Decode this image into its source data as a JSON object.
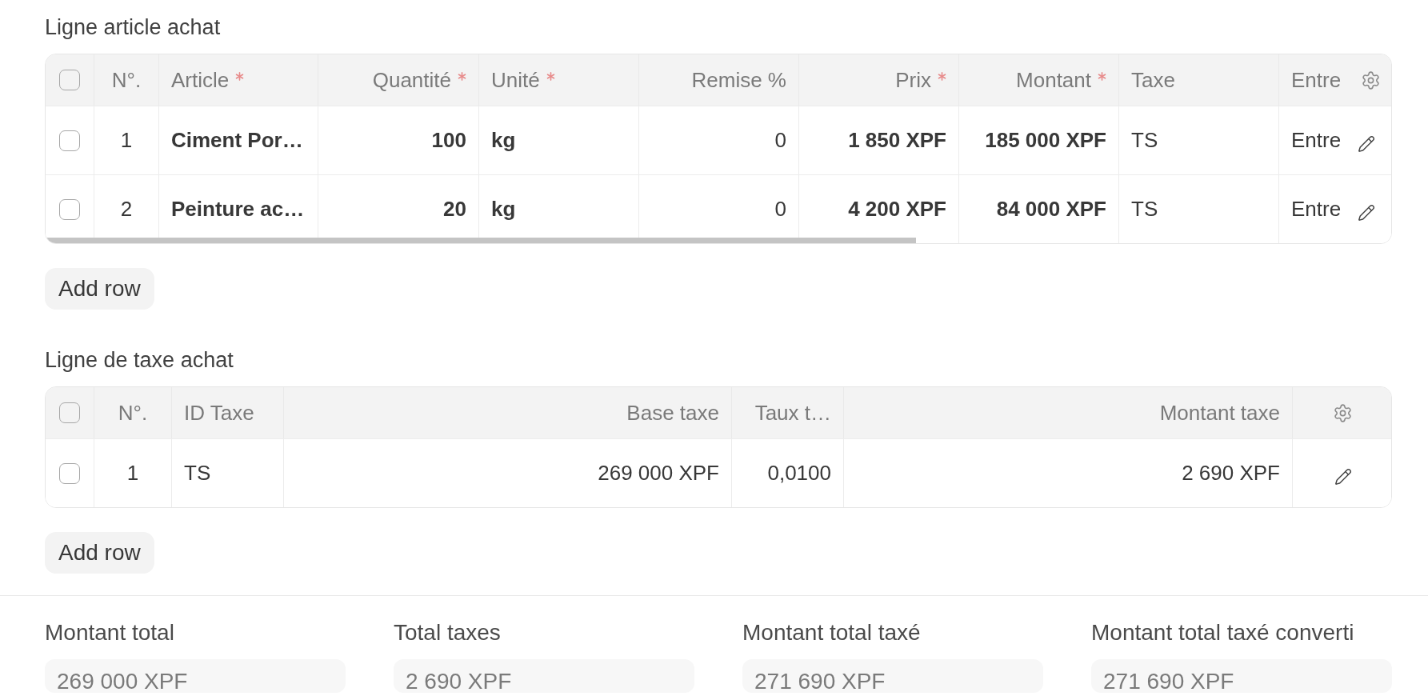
{
  "sections": [
    {
      "title": "Ligne article achat",
      "table": {
        "scrollable": true,
        "all_selected": false,
        "columns": [
          {
            "label": "N°.",
            "kind": "index",
            "required": false
          },
          {
            "label": "Article",
            "kind": "key",
            "required": true
          },
          {
            "label": "Quantité",
            "kind": "amount",
            "required": true
          },
          {
            "label": "Unité",
            "kind": "key",
            "required": true
          },
          {
            "label": "Remise %",
            "kind": "number",
            "required": false
          },
          {
            "label": "Prix",
            "kind": "amount",
            "required": true
          },
          {
            "label": "Montant",
            "kind": "amount",
            "required": true
          },
          {
            "label": "Taxe",
            "kind": "text",
            "required": false
          },
          {
            "label": "Entre",
            "kind": "text",
            "required": false
          }
        ],
        "rows": [
          {
            "selected": false,
            "cells": [
              "1",
              "Ciment Por…",
              "100",
              "kg",
              "0",
              "1 850 XPF",
              "185 000 XPF",
              "TS",
              "Entre"
            ]
          },
          {
            "selected": false,
            "cells": [
              "2",
              "Peinture ac…",
              "20",
              "kg",
              "0",
              "4 200 XPF",
              "84 000 XPF",
              "TS",
              "Entre"
            ]
          }
        ]
      },
      "add_row_button": "Add row"
    },
    {
      "title": "Ligne de taxe achat",
      "table": {
        "scrollable": false,
        "all_selected": false,
        "columns": [
          {
            "label": "N°.",
            "kind": "index",
            "required": false
          },
          {
            "label": "ID Taxe",
            "kind": "text",
            "required": false
          },
          {
            "label": "Base taxe",
            "kind": "number",
            "required": false
          },
          {
            "label": "Taux t…",
            "kind": "number",
            "required": false
          },
          {
            "label": "Montant taxe",
            "kind": "number",
            "required": false
          }
        ],
        "rows": [
          {
            "selected": false,
            "cells": [
              "1",
              "TS",
              "269 000 XPF",
              "0,0100",
              "2 690 XPF"
            ]
          }
        ]
      },
      "add_row_button": "Add row"
    }
  ],
  "totals": [
    {
      "label": "Montant total",
      "value": "269 000 XPF"
    },
    {
      "label": "Total taxes",
      "value": "2 690 XPF"
    },
    {
      "label": "Montant total taxé",
      "value": "271 690 XPF"
    },
    {
      "label": "Montant total taxé converti",
      "value": "271 690 XPF"
    }
  ]
}
